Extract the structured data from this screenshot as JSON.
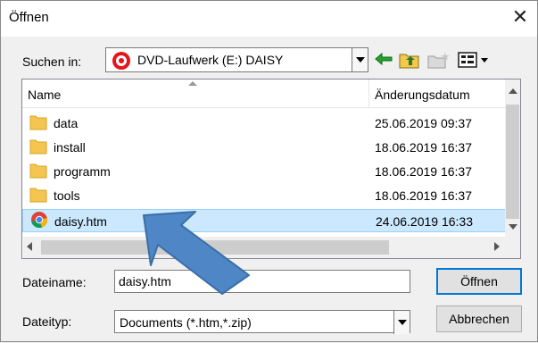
{
  "window": {
    "title": "Öffnen"
  },
  "lookin": {
    "label": "Suchen in:",
    "value": "DVD-Laufwerk (E:) DAISY"
  },
  "toolbar": {
    "icons": [
      "back-arrow-icon",
      "up-folder-icon",
      "new-folder-icon",
      "view-menu-icon"
    ]
  },
  "list": {
    "columns": {
      "name": "Name",
      "date": "Änderungsdatum"
    },
    "rows": [
      {
        "name": "data",
        "date": "25.06.2019 09:37",
        "type": "folder"
      },
      {
        "name": "install",
        "date": "18.06.2019 16:37",
        "type": "folder"
      },
      {
        "name": "programm",
        "date": "18.06.2019 16:37",
        "type": "folder"
      },
      {
        "name": "tools",
        "date": "18.06.2019 16:37",
        "type": "folder"
      },
      {
        "name": "daisy.htm",
        "date": "24.06.2019 16:33",
        "type": "htm-file",
        "selected": true
      }
    ]
  },
  "filename": {
    "label": "Dateiname:",
    "value": "daisy.htm"
  },
  "filetype": {
    "label": "Dateityp:",
    "value": "Documents (*.htm,*.zip)"
  },
  "buttons": {
    "open": "Öffnen",
    "cancel": "Abbrechen"
  },
  "colors": {
    "selection": "#cce8ff",
    "accent": "#0078d7",
    "arrow": "#4f86c6",
    "folder": "#f4c64f"
  }
}
